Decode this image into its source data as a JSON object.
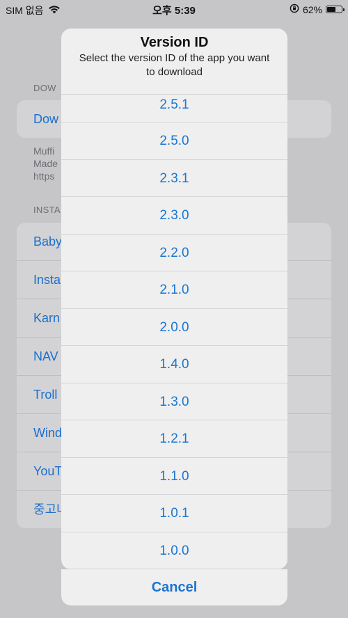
{
  "status_bar": {
    "carrier": "SIM 없음",
    "time": "오후 5:39",
    "battery_percent": "62%",
    "battery_level": 0.62
  },
  "background": {
    "download_section_header": "DOW",
    "download_row": "Dow",
    "footer_lines": [
      "Muffi",
      "Made",
      "https"
    ],
    "installed_section_header": "INSTA",
    "installed_rows": [
      "Baby",
      "Insta",
      "Karn",
      "NAV",
      "Troll",
      "Wind",
      "YouT",
      "중고나"
    ]
  },
  "sheet": {
    "title": "Version ID",
    "message": "Select the version ID of the app you want to download",
    "versions": [
      "2.5.1",
      "2.5.0",
      "2.3.1",
      "2.3.0",
      "2.2.0",
      "2.1.0",
      "2.0.0",
      "1.4.0",
      "1.3.0",
      "1.2.1",
      "1.1.0",
      "1.0.1",
      "1.0.0"
    ],
    "cancel_label": "Cancel"
  },
  "colors": {
    "accent": "#1976d2",
    "sheet_background": "#efeff0",
    "dim_background": "#c6c6c9"
  }
}
